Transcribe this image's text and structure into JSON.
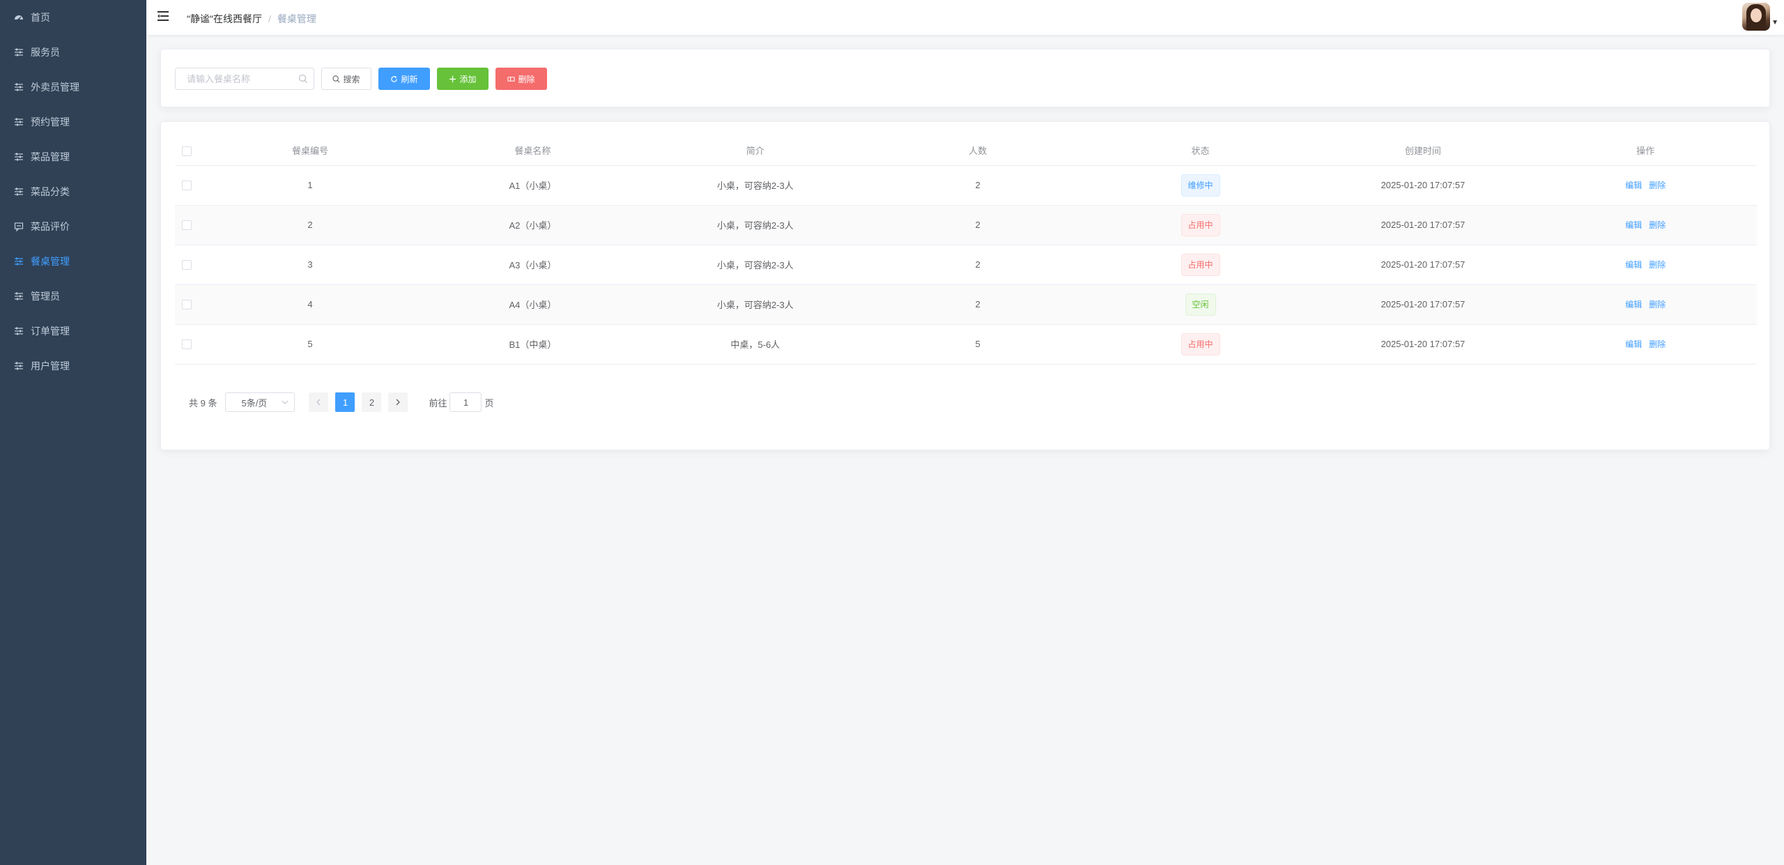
{
  "sidebar": {
    "items": [
      {
        "label": "首页",
        "icon": "dashboard-icon",
        "active": false
      },
      {
        "label": "服务员",
        "icon": "sliders-icon",
        "active": false
      },
      {
        "label": "外卖员管理",
        "icon": "sliders-icon",
        "active": false
      },
      {
        "label": "预约管理",
        "icon": "sliders-icon",
        "active": false
      },
      {
        "label": "菜品管理",
        "icon": "sliders-icon",
        "active": false
      },
      {
        "label": "菜品分类",
        "icon": "sliders-icon",
        "active": false
      },
      {
        "label": "菜品评价",
        "icon": "comment-icon",
        "active": false
      },
      {
        "label": "餐桌管理",
        "icon": "sliders-icon",
        "active": true
      },
      {
        "label": "管理员",
        "icon": "sliders-icon",
        "active": false
      },
      {
        "label": "订单管理",
        "icon": "sliders-icon",
        "active": false
      },
      {
        "label": "用户管理",
        "icon": "sliders-icon",
        "active": false
      }
    ]
  },
  "header": {
    "breadcrumb": {
      "home": "\"静谧\"在线西餐厅",
      "separator": "/",
      "current": "餐桌管理"
    }
  },
  "search": {
    "placeholder": "请输入餐桌名称",
    "search_label": "搜索",
    "refresh_label": "刷新",
    "add_label": "添加",
    "delete_label": "删除"
  },
  "table": {
    "columns": [
      "餐桌编号",
      "餐桌名称",
      "简介",
      "人数",
      "状态",
      "创建时间",
      "操作"
    ],
    "rows": [
      {
        "id": "1",
        "name": "A1（小桌）",
        "desc": "小桌，可容纳2-3人",
        "people": "2",
        "status": "维修中",
        "status_type": "info",
        "created": "2025-01-20 17:07:57"
      },
      {
        "id": "2",
        "name": "A2（小桌）",
        "desc": "小桌，可容纳2-3人",
        "people": "2",
        "status": "占用中",
        "status_type": "danger",
        "created": "2025-01-20 17:07:57"
      },
      {
        "id": "3",
        "name": "A3（小桌）",
        "desc": "小桌，可容纳2-3人",
        "people": "2",
        "status": "占用中",
        "status_type": "danger",
        "created": "2025-01-20 17:07:57"
      },
      {
        "id": "4",
        "name": "A4（小桌）",
        "desc": "小桌，可容纳2-3人",
        "people": "2",
        "status": "空闲",
        "status_type": "success",
        "created": "2025-01-20 17:07:57"
      },
      {
        "id": "5",
        "name": "B1（中桌）",
        "desc": "中桌，5-6人",
        "people": "5",
        "status": "占用中",
        "status_type": "danger",
        "created": "2025-01-20 17:07:57"
      }
    ],
    "edit_label": "编辑",
    "delete_label": "删除"
  },
  "pagination": {
    "total_text": "共 9 条",
    "page_size": "5条/页",
    "pages": [
      "1",
      "2"
    ],
    "current_page": "1",
    "goto_label": "前往",
    "goto_value": "1",
    "page_suffix": "页"
  },
  "colors": {
    "sidebar_bg": "#304156",
    "sidebar_text": "#bfcbd9",
    "accent": "#409eff",
    "success": "#67c23a",
    "danger": "#f56c6c"
  }
}
